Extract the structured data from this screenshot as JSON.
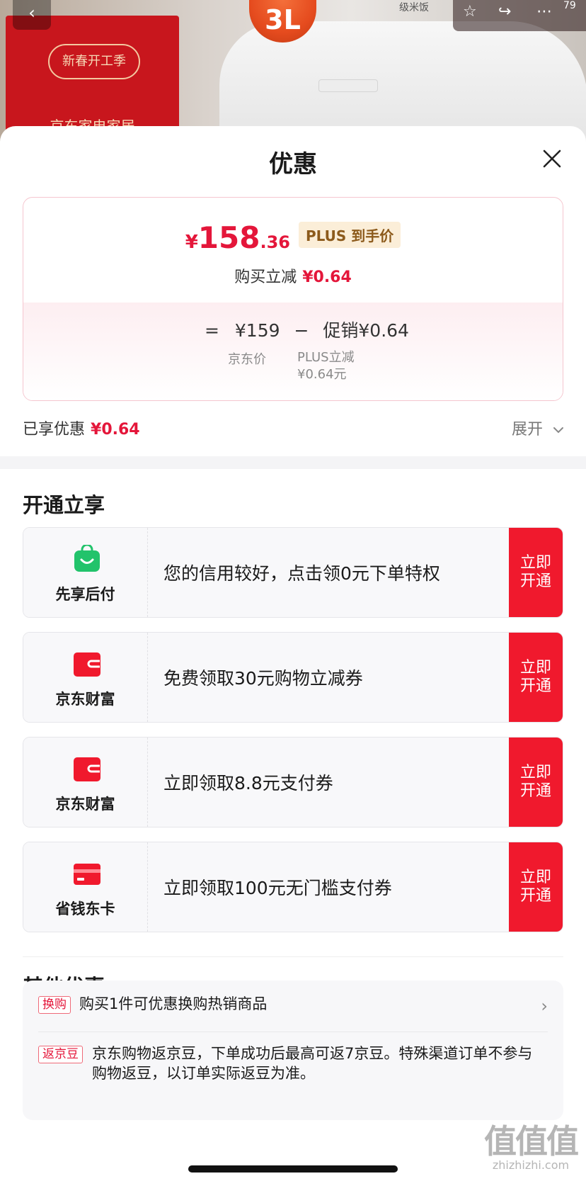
{
  "background": {
    "store_logo_text": "新春开工季",
    "store_name": "京东家电家居",
    "capacity_badge": "3L",
    "rice_label": "级米饭",
    "back_icon": "chevron-left-icon",
    "corner_count": "79"
  },
  "sheet": {
    "title": "优惠",
    "close_icon": "close-icon"
  },
  "price_card": {
    "currency": "¥",
    "price_int": "158",
    "price_dec": ".36",
    "plus_tag": "PLUS 到手价",
    "reduce_label": "购买立减",
    "reduce_value": "¥0.64",
    "calc_eq": "=",
    "calc_base": "¥159",
    "calc_minus": "−",
    "calc_promo": "促销¥0.64",
    "calc_base_label": "京东价",
    "calc_promo_label": "PLUS立减",
    "calc_promo_sub": "¥0.64元"
  },
  "summary": {
    "enjoyed_label": "已享优惠",
    "enjoyed_value": "¥0.64",
    "expand_label": "展开"
  },
  "open_section": {
    "title": "开通立享",
    "cards": [
      {
        "icon": "bag-icon",
        "name": "先享后付",
        "desc": "您的信用较好，点击领0元下单特权",
        "button": "立即开通",
        "color": "#22c36b"
      },
      {
        "icon": "wallet-icon",
        "name": "京东财富",
        "desc": "免费领取30元购物立减券",
        "button": "立即开通",
        "color": "#f0192d"
      },
      {
        "icon": "wallet-icon",
        "name": "京东财富",
        "desc": "立即领取8.8元支付券",
        "button": "立即开通",
        "color": "#f0192d"
      },
      {
        "icon": "card-icon",
        "name": "省钱东卡",
        "desc": "立即领取100元无门槛支付券",
        "button": "立即开通",
        "color": "#f0192d"
      }
    ]
  },
  "other_section": {
    "title": "其他优惠",
    "offers": [
      {
        "tag": "换购",
        "text": "购买1件可优惠换购热销商品"
      },
      {
        "tag": "返京豆",
        "text": "京东购物返京豆，下单成功后最高可返7京豆。特殊渠道订单不参与购物返豆，以订单实际返豆为准。"
      }
    ]
  },
  "watermark": {
    "big": "值值值",
    "small": "zhizhizhi.com"
  },
  "colors": {
    "accent_red": "#e4163a",
    "button_red": "#f0192d",
    "plus_gold": "#8c5a1b"
  }
}
